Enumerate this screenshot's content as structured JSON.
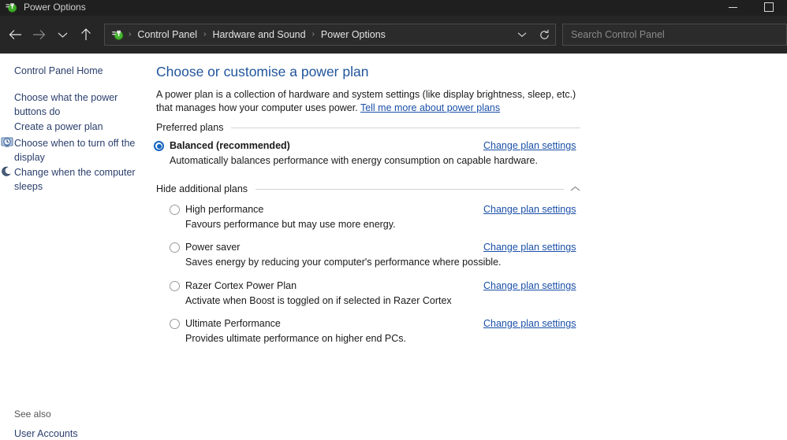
{
  "window": {
    "title": "Power Options",
    "title_icon": "power-options-icon",
    "controls": {
      "minimize": "minimize-icon",
      "maximize": "maximize-icon"
    }
  },
  "toolbar": {
    "back": "back-arrow-icon",
    "forward": "forward-arrow-icon",
    "recent": "chevron-down-icon",
    "up": "up-arrow-icon",
    "breadcrumb_icon": "power-options-icon",
    "breadcrumbs": [
      "Control Panel",
      "Hardware and Sound",
      "Power Options"
    ],
    "separator": "›",
    "history_dropdown": "chevron-down-icon",
    "refresh": "refresh-icon",
    "search": {
      "placeholder": "Search Control Panel",
      "value": ""
    }
  },
  "sidebar": {
    "home": "Control Panel Home",
    "items": [
      {
        "label": "Choose what the power buttons do",
        "icon": null
      },
      {
        "label": "Create a power plan",
        "icon": null
      },
      {
        "label": "Choose when to turn off the display",
        "icon": "display-clock-icon"
      },
      {
        "label": "Change when the computer sleeps",
        "icon": "moon-sleep-icon"
      }
    ],
    "see_also_label": "See also",
    "see_also_link": "User Accounts"
  },
  "main": {
    "title": "Choose or customise a power plan",
    "description_part1": "A power plan is a collection of hardware and system settings (like display brightness, sleep, etc.) that manages how your computer uses power. ",
    "description_link": "Tell me more about power plans",
    "preferred_section": {
      "label": "Preferred plans"
    },
    "additional_section": {
      "label": "Hide additional plans",
      "chevron": "chevron-up-icon"
    },
    "change_link_label": "Change plan settings",
    "preferred_plans": [
      {
        "name": "Balanced (recommended)",
        "description": "Automatically balances performance with energy consumption on capable hardware.",
        "selected": true
      }
    ],
    "additional_plans": [
      {
        "name": "High performance",
        "description": "Favours performance but may use more energy.",
        "selected": false
      },
      {
        "name": "Power saver",
        "description": "Saves energy by reducing your computer's performance where possible.",
        "selected": false
      },
      {
        "name": "Razer Cortex Power Plan",
        "description": "Activate when Boost is toggled on if selected in Razer Cortex",
        "selected": false
      },
      {
        "name": "Ultimate Performance",
        "description": "Provides ultimate performance on higher end PCs.",
        "selected": false
      }
    ]
  },
  "colors": {
    "titlebar_bg": "#1f1f1f",
    "toolbar_bg": "#262626",
    "content_bg": "#ffffff",
    "accent_blue": "#20559c",
    "link_blue": "#1b50a8",
    "sidebar_link": "#2b3f6c",
    "radio_selected": "#1565c0"
  }
}
